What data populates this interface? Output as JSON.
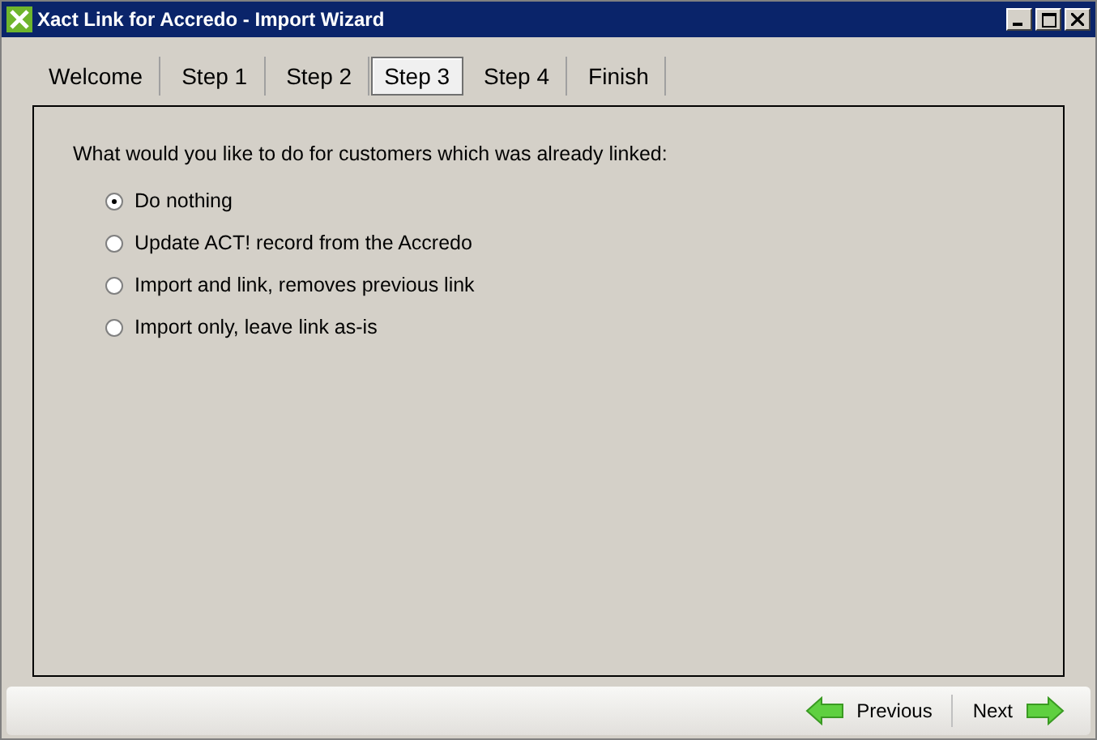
{
  "window": {
    "title": "Xact Link for Accredo - Import Wizard"
  },
  "tabs": [
    {
      "label": "Welcome",
      "selected": false
    },
    {
      "label": "Step 1",
      "selected": false
    },
    {
      "label": "Step 2",
      "selected": false
    },
    {
      "label": "Step 3",
      "selected": true
    },
    {
      "label": "Step 4",
      "selected": false
    },
    {
      "label": "Finish",
      "selected": false
    }
  ],
  "question": "What would you like to do for customers which was already linked:",
  "options": [
    {
      "label": "Do nothing",
      "selected": true
    },
    {
      "label": "Update ACT! record from the Accredo",
      "selected": false
    },
    {
      "label": "Import and link, removes previous link",
      "selected": false
    },
    {
      "label": "Import only, leave link as-is",
      "selected": false
    }
  ],
  "buttons": {
    "previous": "Previous",
    "next": "Next"
  }
}
